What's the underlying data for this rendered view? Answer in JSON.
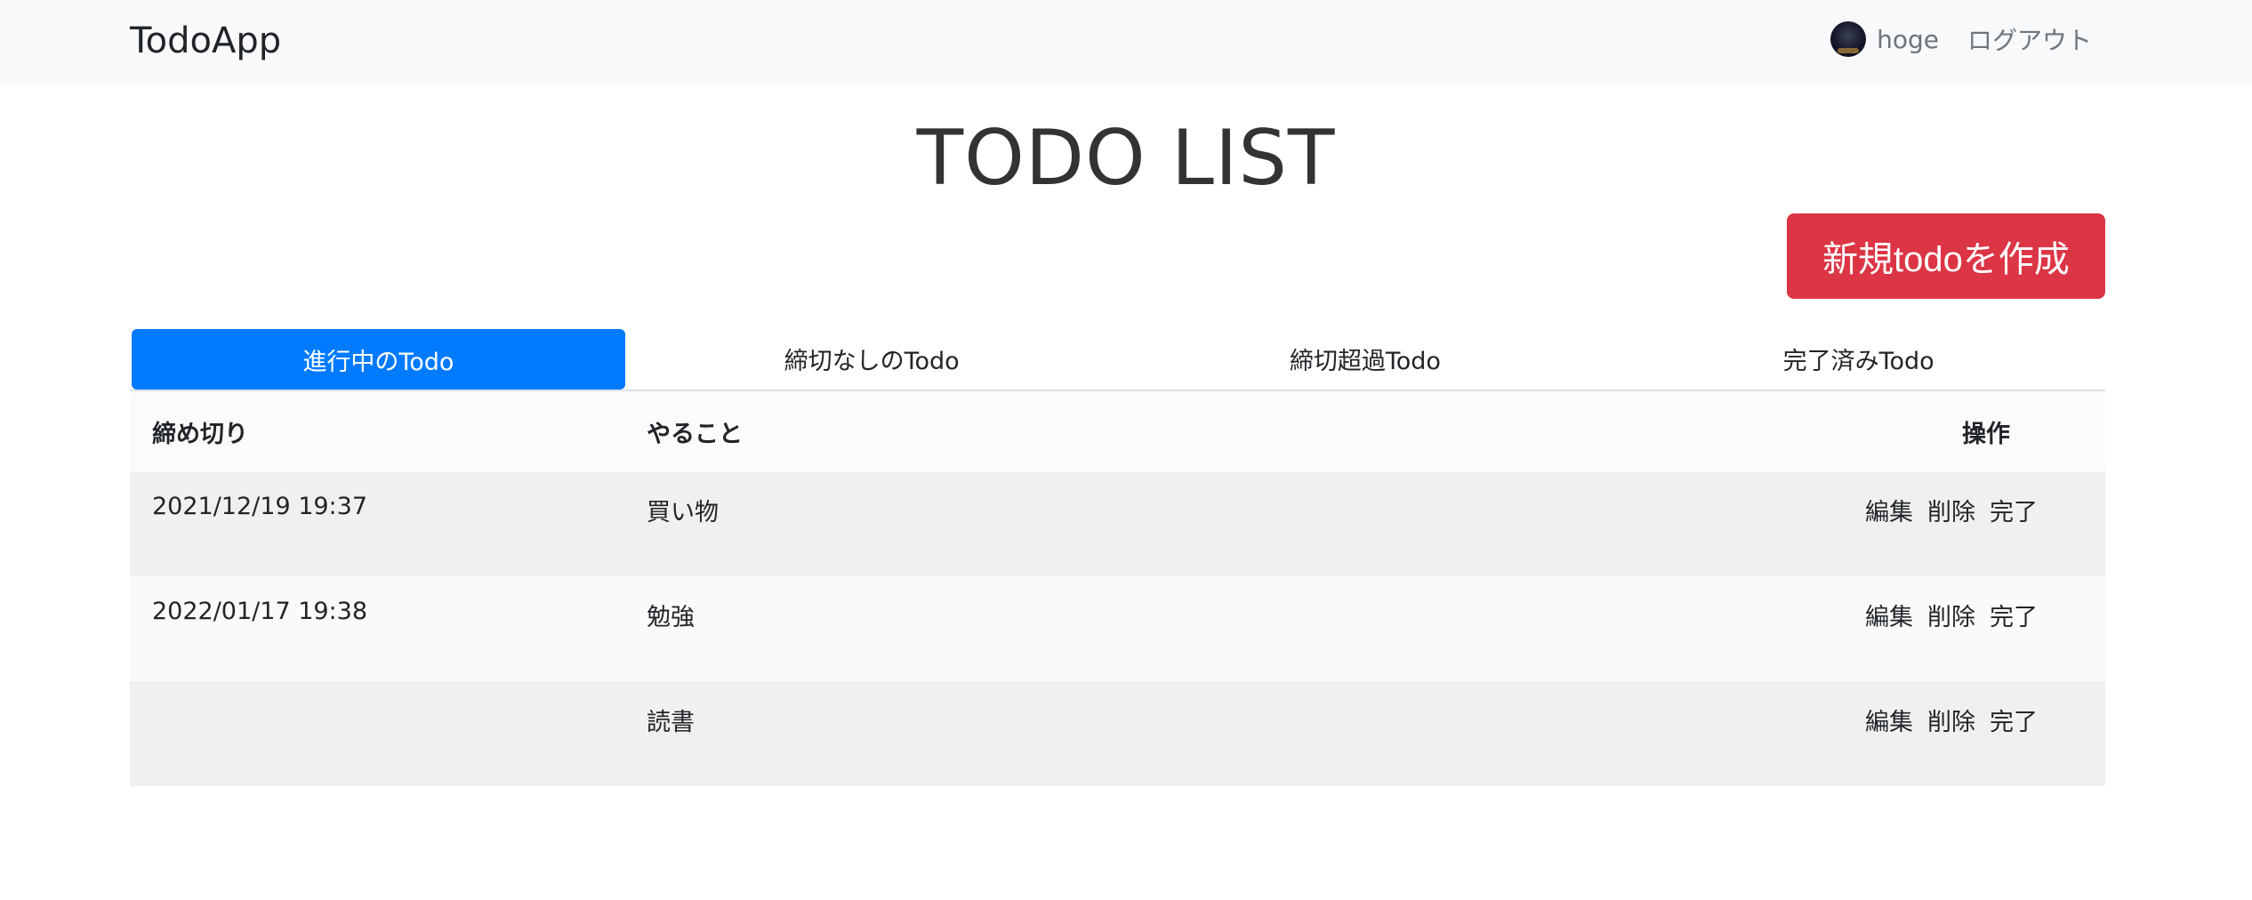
{
  "navbar": {
    "brand": "TodoApp",
    "user": {
      "name": "hoge",
      "avatar_icon": "user-avatar"
    },
    "logout_label": "ログアウト"
  },
  "page": {
    "title": "TODO LIST",
    "new_button_label": "新規todoを作成"
  },
  "tabs": [
    {
      "label": "進行中のTodo",
      "active": true
    },
    {
      "label": "締切なしのTodo",
      "active": false
    },
    {
      "label": "締切超過Todo",
      "active": false
    },
    {
      "label": "完了済みTodo",
      "active": false
    }
  ],
  "table": {
    "headers": {
      "deadline": "締め切り",
      "task": "やること",
      "actions": "操作"
    },
    "rows": [
      {
        "deadline": "2021/12/19 19:37",
        "task": "買い物",
        "edit": "編集",
        "delete": "削除",
        "complete": "完了"
      },
      {
        "deadline": "2022/01/17 19:38",
        "task": "勉強",
        "edit": "編集",
        "delete": "削除",
        "complete": "完了"
      },
      {
        "deadline": "",
        "task": "読書",
        "edit": "編集",
        "delete": "削除",
        "complete": "完了"
      }
    ]
  },
  "colors": {
    "navbar_bg": "#f8f9fa",
    "primary": "#007bff",
    "danger": "#dc3545",
    "row_odd": "#f0f0f0",
    "row_even": "#fafafa"
  }
}
